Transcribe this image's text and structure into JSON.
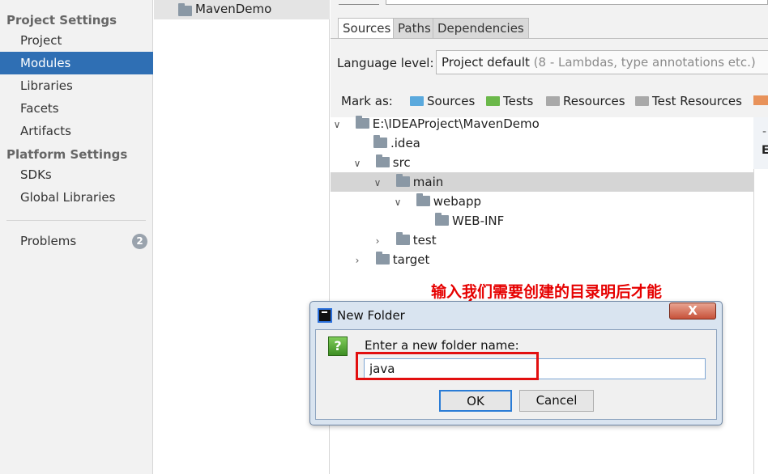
{
  "left_panel": {
    "project_settings_heading": "Project Settings",
    "project_items": [
      "Project",
      "Modules",
      "Libraries",
      "Facets",
      "Artifacts"
    ],
    "selected_item": "Modules",
    "platform_settings_heading": "Platform Settings",
    "platform_items": [
      "SDKs",
      "Global Libraries"
    ],
    "problems_label": "Problems",
    "problems_count": "2"
  },
  "modules_list": {
    "items": [
      "MavenDemo"
    ]
  },
  "detail": {
    "tabs": [
      "Sources",
      "Paths",
      "Dependencies"
    ],
    "active_tab": "Sources",
    "language_level_label": "Language level:",
    "language_level_value": "Project default",
    "language_level_detail": "(8 - Lambdas, type annotations etc.)",
    "mark_as_label": "Mark as:",
    "mark_as": [
      {
        "label": "Sources",
        "color": "#5aa9dd"
      },
      {
        "label": "Tests",
        "color": "#6bb84a"
      },
      {
        "label": "Resources",
        "color": "#a9a9a9"
      },
      {
        "label": "Test Resources",
        "color": "#a9a9a9"
      }
    ]
  },
  "tree": {
    "rows": [
      {
        "label": "E:\\IDEAProject\\MavenDemo",
        "chevron": "down"
      },
      {
        "label": ".idea",
        "chevron": ""
      },
      {
        "label": "src",
        "chevron": "down"
      },
      {
        "label": "main",
        "chevron": "down",
        "selected": true
      },
      {
        "label": "webapp",
        "chevron": "down"
      },
      {
        "label": "WEB-INF",
        "chevron": ""
      },
      {
        "label": "test",
        "chevron": "right"
      },
      {
        "label": "target",
        "chevron": "right"
      }
    ]
  },
  "annotation": {
    "text": "输入我们需要创建的目录明后才能",
    "color": "#e60000"
  },
  "dialog": {
    "title": "New Folder",
    "close_symbol": "X",
    "prompt": "Enter a new folder name:",
    "input_value": "java",
    "ok_label": "OK",
    "cancel_label": "Cancel",
    "question_symbol": "?"
  },
  "sliver": {
    "dash": "-",
    "letter": "E"
  }
}
